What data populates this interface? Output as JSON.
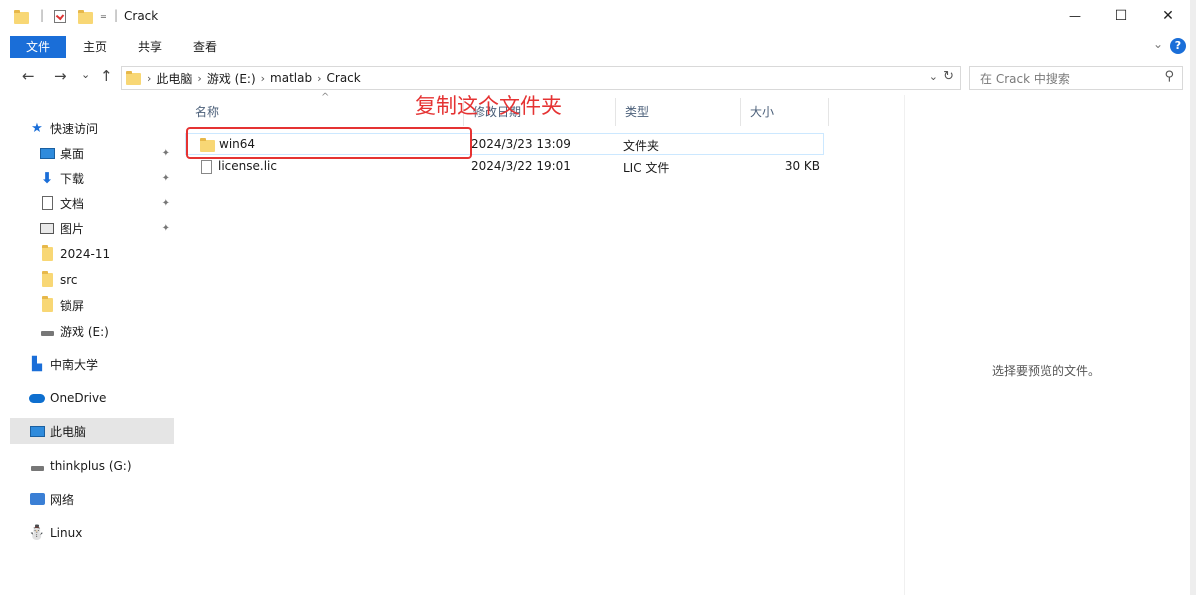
{
  "window": {
    "title": "Crack",
    "min_glyph": "—",
    "max_glyph": "☐",
    "close_glyph": "✕",
    "qa_sep": "|",
    "qa_dropdown": "₌"
  },
  "ribbon": {
    "tabs": [
      {
        "label": "文件"
      },
      {
        "label": "主页"
      },
      {
        "label": "共享"
      },
      {
        "label": "查看"
      }
    ],
    "expand_glyph": "⌄",
    "help_glyph": "?"
  },
  "nav": {
    "back": "←",
    "forward": "→",
    "recent": "⌄",
    "up": "↑"
  },
  "address": {
    "crumbs": [
      "此电脑",
      "游戏 (E:)",
      "matlab",
      "Crack"
    ],
    "sep": "›",
    "dropdown": "⌄",
    "refresh": "↻"
  },
  "search": {
    "placeholder": "在 Crack 中搜索",
    "icon_glyph": "⚲"
  },
  "navpane": {
    "quick_access": "快速访问",
    "items": [
      {
        "label": "桌面",
        "icon": "desktop-icon",
        "pinned": true
      },
      {
        "label": "下载",
        "icon": "download-icon",
        "pinned": true
      },
      {
        "label": "文档",
        "icon": "documents-icon",
        "pinned": true
      },
      {
        "label": "图片",
        "icon": "pictures-icon",
        "pinned": true
      },
      {
        "label": "2024-11",
        "icon": "folder-icon",
        "pinned": false
      },
      {
        "label": "src",
        "icon": "folder-icon",
        "pinned": false
      },
      {
        "label": "锁屏",
        "icon": "folder-icon",
        "pinned": false
      },
      {
        "label": "游戏 (E:)",
        "icon": "drive-icon",
        "pinned": false
      }
    ],
    "csu": "中南大学",
    "onedrive": "OneDrive",
    "thispc": "此电脑",
    "thinkplus": "thinkplus (G:)",
    "network": "网络",
    "linux": "Linux",
    "pin_glyph": "📌"
  },
  "columns": {
    "name": "名称",
    "date": "修改日期",
    "type": "类型",
    "size": "大小",
    "sort_glyph": "^"
  },
  "files": [
    {
      "name": "win64",
      "date": "2024/3/23 13:09",
      "type": "文件夹",
      "size": ""
    },
    {
      "name": "license.lic",
      "date": "2024/3/22 19:01",
      "type": "LIC 文件",
      "size": "30 KB"
    }
  ],
  "annotation": {
    "text": "复制这个文件夹",
    "color": "#e53333"
  },
  "preview": {
    "message": "选择要预览的文件。"
  }
}
